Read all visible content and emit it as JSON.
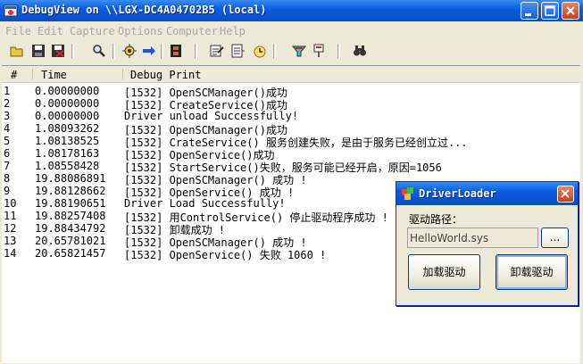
{
  "window": {
    "title": "DebugView on \\\\LGX-DC4A04702B5 (local)"
  },
  "menu": [
    "File",
    "Edit",
    "Capture",
    "Options",
    "Computer",
    "Help"
  ],
  "toolbar_icons": [
    "open-icon",
    "save-icon",
    "clear-icon",
    "find-icon",
    "capture-icon",
    "autoscroll-arrow-icon",
    "film-icon",
    "filter-icon",
    "history-icon",
    "clock-icon",
    "highlight-icon",
    "pin-icon",
    "binoculars-icon"
  ],
  "columns": {
    "num": "#",
    "time": "Time",
    "print": "Debug Print"
  },
  "rows": [
    {
      "num": "1",
      "time": "0.00000000",
      "print": "[1532] OpenSCManager()成功"
    },
    {
      "num": "2",
      "time": "0.00000000",
      "print": "[1532] CreateService()成功"
    },
    {
      "num": "3",
      "time": "0.00000000",
      "print": "Driver unload Successfully!"
    },
    {
      "num": "4",
      "time": "1.08093262",
      "print": "[1532] OpenSCManager()成功"
    },
    {
      "num": "5",
      "time": "1.08138525",
      "print": "[1532] CrateService() 服务创建失败，是由于服务已经创立过..."
    },
    {
      "num": "6",
      "time": "1.08178163",
      "print": "[1532] OpenService()成功"
    },
    {
      "num": "7",
      "time": "1.08558428",
      "print": "[1532] StartService()失败，服务可能已经开启，原因=1056"
    },
    {
      "num": "8",
      "time": "19.88086891",
      "print": "[1532] OpenSCManager() 成功 !"
    },
    {
      "num": "9",
      "time": "19.88128662",
      "print": "[1532] OpenService() 成功 !"
    },
    {
      "num": "10",
      "time": "19.88190651",
      "print": "Driver Load Successfully!"
    },
    {
      "num": "11",
      "time": "19.88257408",
      "print": "[1532] 用ControlService() 停止驱动程序成功 !"
    },
    {
      "num": "12",
      "time": "19.88434792",
      "print": "[1532] 卸载成功 !"
    },
    {
      "num": "13",
      "time": "20.65781021",
      "print": "[1532] OpenSCManager() 成功 !"
    },
    {
      "num": "14",
      "time": "20.65821457",
      "print": "[1532] OpenService() 失败 1060 !"
    }
  ],
  "dialog": {
    "title": "DriverLoader",
    "path_label": "驱动路径：",
    "path_value": "HelloWorld.sys",
    "browse_label": "...",
    "load_label": "加载驱动",
    "unload_label": "卸载驱动"
  },
  "colors": {
    "title_blue": "#0a5ee0",
    "close_red": "#c2411c",
    "menu_disabled": "#a8a8a8"
  }
}
